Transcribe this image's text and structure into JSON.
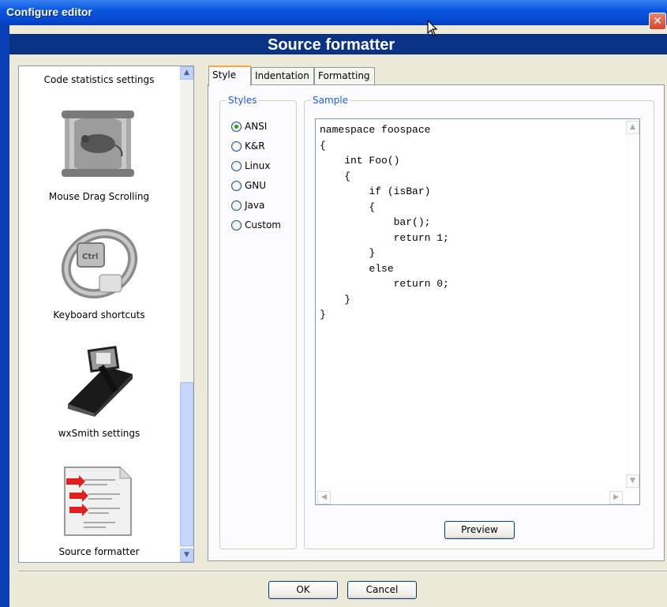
{
  "window": {
    "title": "Configure editor",
    "close_glyph": "✕"
  },
  "header": {
    "title": "Source formatter"
  },
  "sidebar": {
    "items": [
      {
        "label": "Code statistics settings",
        "icon": "chart-icon"
      },
      {
        "label": "Mouse Drag Scrolling",
        "icon": "mouse-scroll-icon"
      },
      {
        "label": "Keyboard shortcuts",
        "icon": "keyboard-key-icon"
      },
      {
        "label": "wxSmith settings",
        "icon": "wxsmith-icon"
      },
      {
        "label": "Source formatter",
        "icon": "document-format-icon"
      }
    ]
  },
  "tabs": [
    {
      "label": "Style",
      "active": true
    },
    {
      "label": "Indentation",
      "active": false
    },
    {
      "label": "Formatting",
      "active": false
    }
  ],
  "styles": {
    "label": "Styles",
    "options": [
      "ANSI",
      "K&R",
      "Linux",
      "GNU",
      "Java",
      "Custom"
    ],
    "selected": "ANSI"
  },
  "sample": {
    "label": "Sample",
    "code": "namespace foospace\n{\n    int Foo()\n    {\n        if (isBar)\n        {\n            bar();\n            return 1;\n        }\n        else\n            return 0;\n    }\n}"
  },
  "buttons": {
    "preview": "Preview",
    "ok": "OK",
    "cancel": "Cancel"
  },
  "colors": {
    "titlebar": "#0a58e0",
    "header_band": "#0a3386",
    "accent": "#1c5bd8",
    "tab_highlight": "#f7a93a"
  }
}
